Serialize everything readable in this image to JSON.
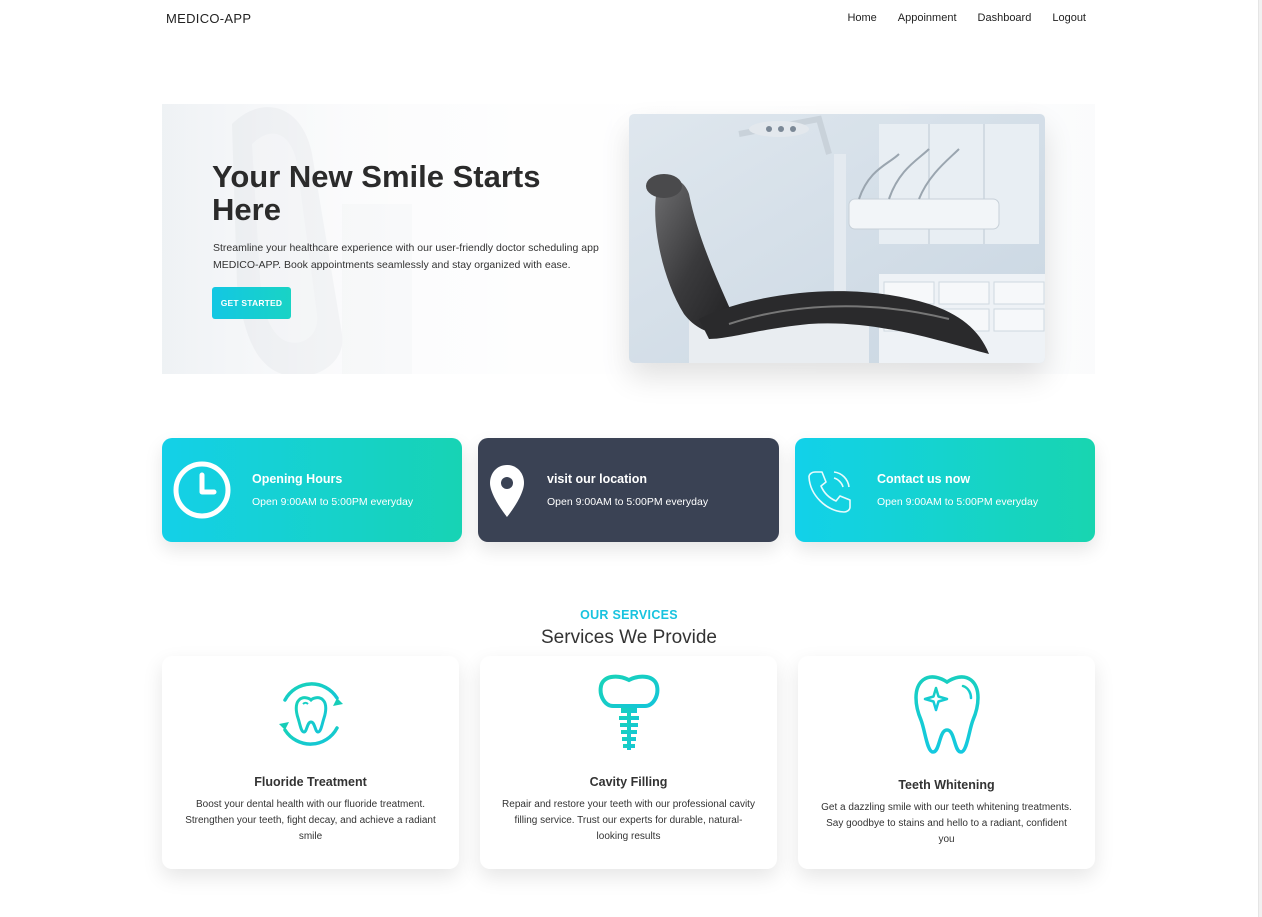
{
  "nav": {
    "brand": "MEDICO-APP",
    "links": [
      "Home",
      "Appoinment",
      "Dashboard",
      "Logout"
    ]
  },
  "hero": {
    "title": "Your New Smile Starts Here",
    "description": "Streamline your healthcare experience with our user-friendly doctor scheduling app MEDICO-APP. Book appointments seamlessly and stay organized with ease.",
    "cta_label": "GET STARTED"
  },
  "info_cards": [
    {
      "icon": "clock-icon",
      "title": "Opening Hours",
      "text": "Open 9:00AM to 5:00PM everyday"
    },
    {
      "icon": "location-pin-icon",
      "title": "visit our location",
      "text": "Open 9:00AM to 5:00PM everyday"
    },
    {
      "icon": "phone-icon",
      "title": "Contact us now",
      "text": "Open 9:00AM to 5:00PM everyday"
    }
  ],
  "services": {
    "kicker": "OUR SERVICES",
    "heading": "Services We Provide",
    "items": [
      {
        "icon": "fluoride-tooth-icon",
        "title": "Fluoride Treatment",
        "description": "Boost your dental health with our fluoride treatment. Strengthen your teeth, fight decay, and achieve a radiant smile"
      },
      {
        "icon": "dental-implant-icon",
        "title": "Cavity Filling",
        "description": "Repair and restore your teeth with our professional cavity filling service. Trust our experts for durable, natural-looking results"
      },
      {
        "icon": "sparkle-tooth-icon",
        "title": "Teeth Whitening",
        "description": "Get a dazzling smile with our teeth whitening treatments. Say goodbye to stains and hello to a radiant, confident you"
      }
    ]
  },
  "colors": {
    "accent": "#19c3df",
    "teal": "#17d3b4",
    "dark_card": "#3a4254"
  }
}
